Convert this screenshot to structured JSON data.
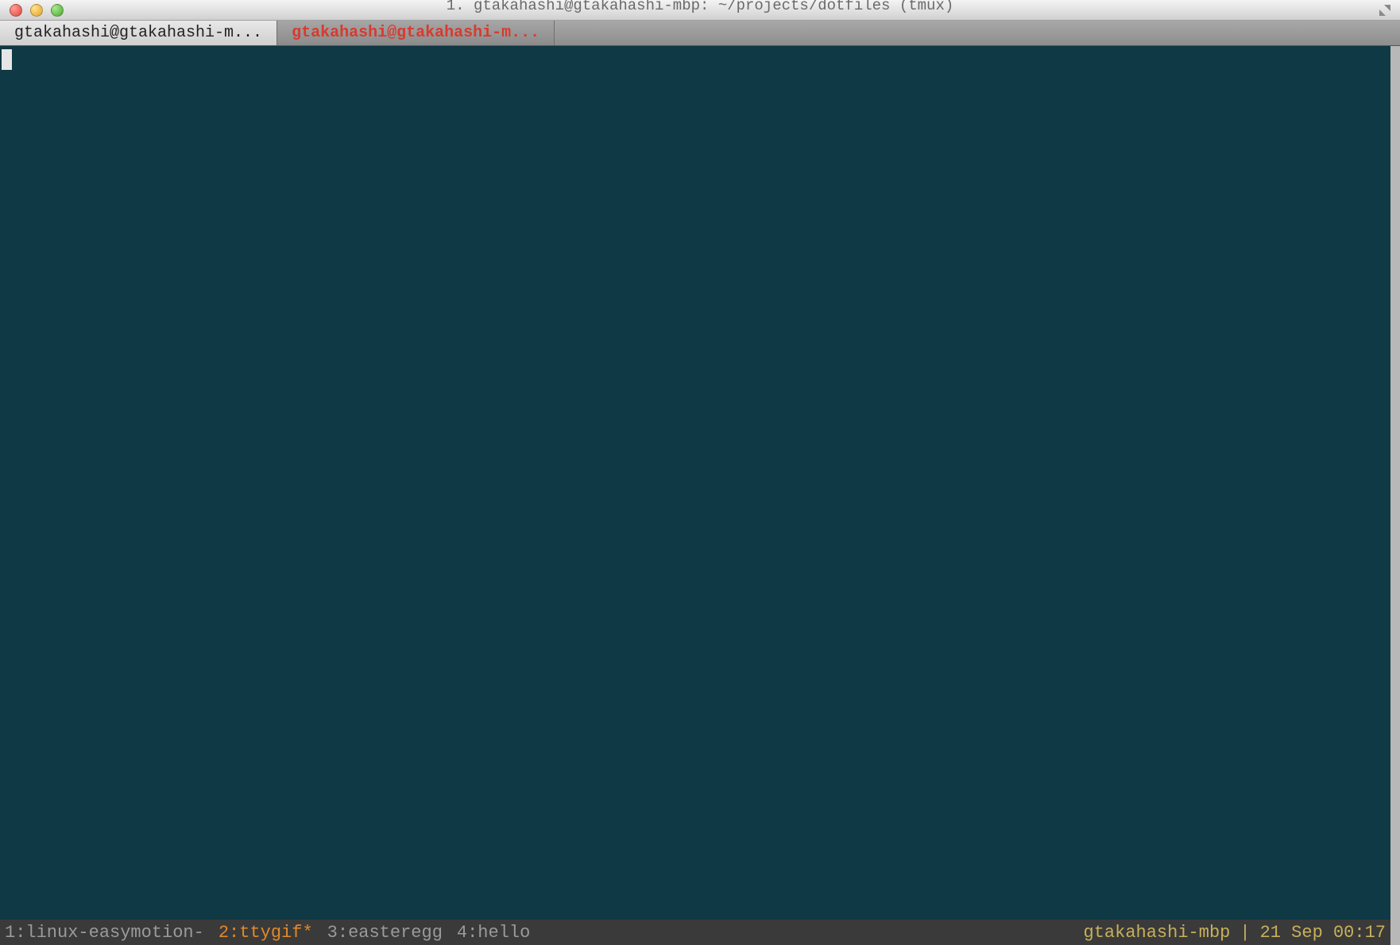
{
  "titlebar": {
    "title": "1. gtakahashi@gtakahashi-mbp: ~/projects/dotfiles (tmux)"
  },
  "tabs": [
    {
      "label": "gtakahashi@gtakahashi-m...",
      "active": true
    },
    {
      "label": "gtakahashi@gtakahashi-m...",
      "active": false
    }
  ],
  "tmux": {
    "windows": [
      {
        "label": "1:linux-easymotion-",
        "state": "dim"
      },
      {
        "label": "2:ttygif*",
        "state": "active"
      },
      {
        "label": "3:easteregg",
        "state": "dim"
      },
      {
        "label": "4:hello",
        "state": "dim"
      }
    ],
    "host": "gtakahashi-mbp",
    "separator": "|",
    "datetime": "21 Sep 00:17"
  }
}
